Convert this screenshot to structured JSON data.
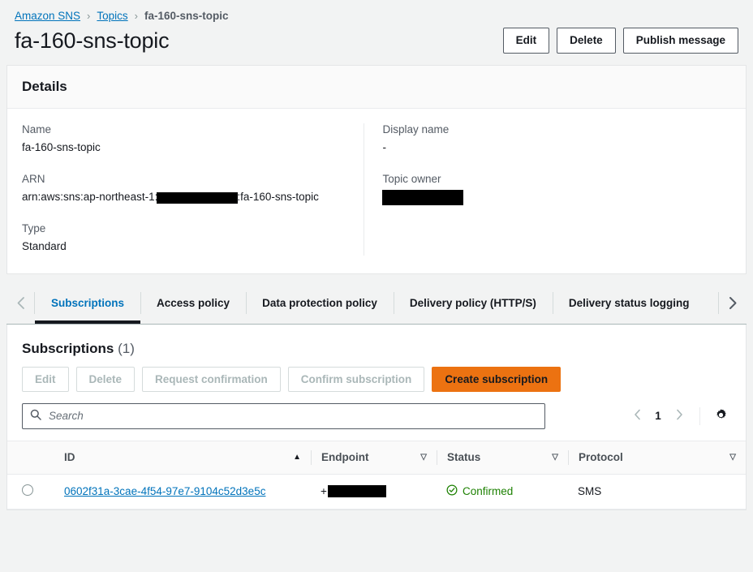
{
  "breadcrumb": {
    "items": [
      {
        "label": "Amazon SNS",
        "link": true
      },
      {
        "label": "Topics",
        "link": true
      },
      {
        "label": "fa-160-sns-topic",
        "link": false
      }
    ],
    "separator": "›"
  },
  "header": {
    "title": "fa-160-sns-topic",
    "actions": {
      "edit": "Edit",
      "delete": "Delete",
      "publish": "Publish message"
    }
  },
  "details": {
    "heading": "Details",
    "left": {
      "name_label": "Name",
      "name_value": "fa-160-sns-topic",
      "arn_label": "ARN",
      "arn_prefix": "arn:aws:sns:ap-northeast-1:",
      "arn_suffix": ":fa-160-sns-topic",
      "type_label": "Type",
      "type_value": "Standard"
    },
    "right": {
      "display_name_label": "Display name",
      "display_name_value": "-",
      "topic_owner_label": "Topic owner"
    }
  },
  "tabs": {
    "prev_icon": "chevron-left-icon",
    "next_icon": "chevron-right-icon",
    "items": [
      {
        "label": "Subscriptions",
        "active": true
      },
      {
        "label": "Access policy",
        "active": false
      },
      {
        "label": "Data protection policy",
        "active": false
      },
      {
        "label": "Delivery policy (HTTP/S)",
        "active": false
      },
      {
        "label": "Delivery status logging",
        "active": false
      }
    ]
  },
  "subscriptions": {
    "title": "Subscriptions",
    "count": "(1)",
    "actions": {
      "edit": "Edit",
      "delete": "Delete",
      "request_confirmation": "Request confirmation",
      "confirm_subscription": "Confirm subscription",
      "create_subscription": "Create subscription"
    },
    "search": {
      "placeholder": "Search",
      "value": "",
      "icon": "search-icon"
    },
    "pagination": {
      "prev_icon": "chevron-left-icon",
      "page": "1",
      "next_icon": "chevron-right-icon",
      "settings_icon": "gear-icon"
    },
    "columns": [
      {
        "label": "ID",
        "sort": "asc"
      },
      {
        "label": "Endpoint",
        "sort": "none"
      },
      {
        "label": "Status",
        "sort": "none"
      },
      {
        "label": "Protocol",
        "sort": "none"
      }
    ],
    "rows": [
      {
        "id": "0602f31a-3cae-4f54-97e7-9104c52d3e5c",
        "endpoint_prefix": "+",
        "endpoint_redacted": true,
        "status": "Confirmed",
        "status_icon": "check-circle-icon",
        "protocol": "SMS"
      }
    ]
  },
  "colors": {
    "link": "#0073bb",
    "primary_button": "#ec7211",
    "success": "#1d8102",
    "page_background": "#f2f3f3"
  }
}
